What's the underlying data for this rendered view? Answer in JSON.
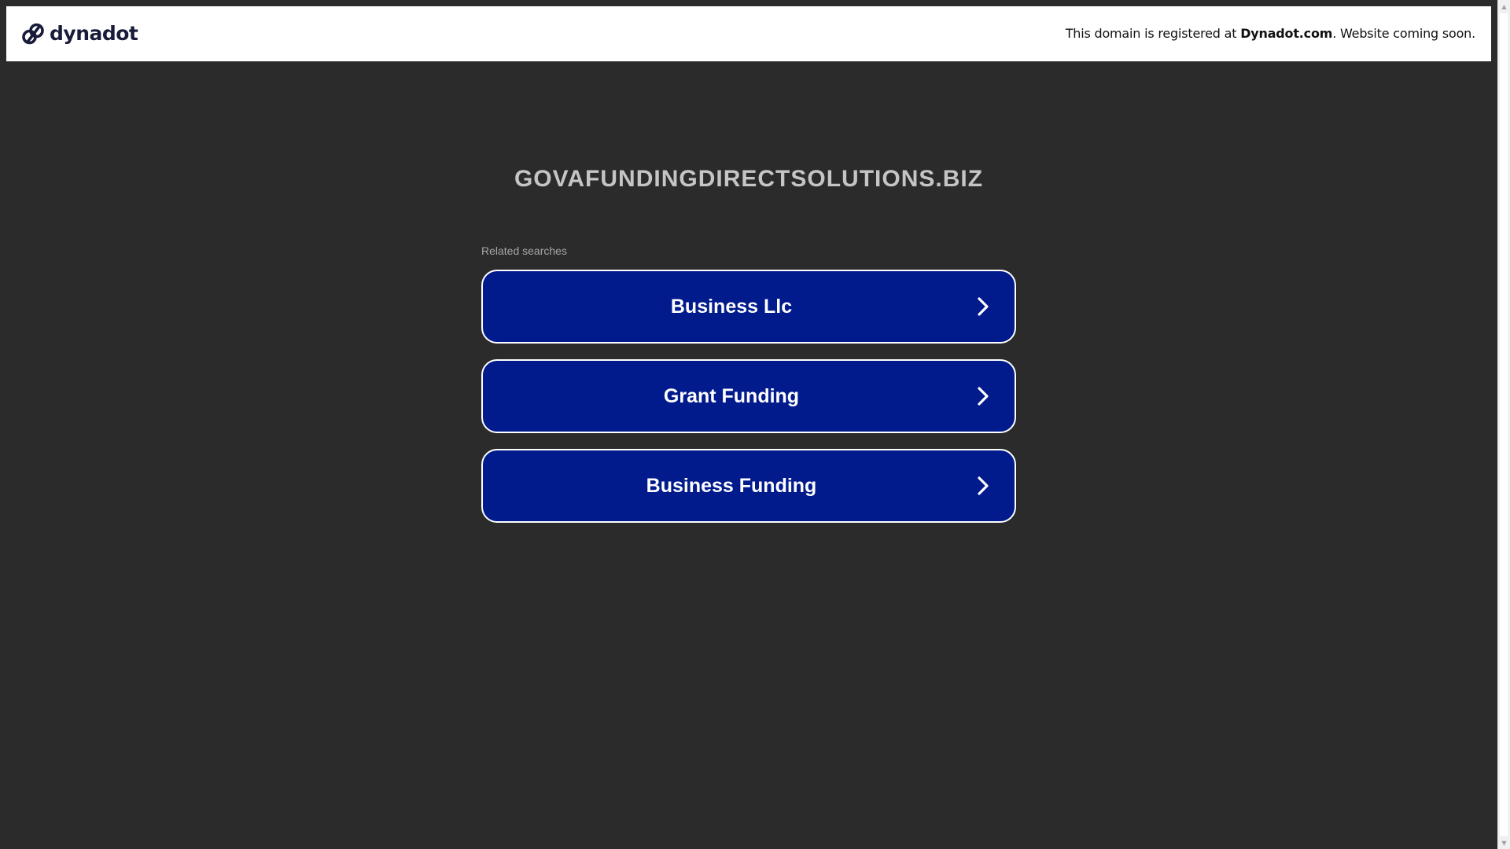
{
  "header": {
    "logo_text": "dynadot",
    "logo_icon": "dynadot-logo-icon",
    "notice_prefix": "This domain is registered at ",
    "notice_brand": "Dynadot.com",
    "notice_suffix": ". Website coming soon."
  },
  "main": {
    "domain_name": "GOVAFUNDINGDIRECTSOLUTIONS.BIZ",
    "related_label": "Related searches",
    "searches": [
      {
        "label": "Business Llc",
        "icon": "chevron-right-icon"
      },
      {
        "label": "Grant Funding",
        "icon": "chevron-right-icon"
      },
      {
        "label": "Business Funding",
        "icon": "chevron-right-icon"
      }
    ]
  },
  "colors": {
    "page_background": "#2b2b2b",
    "header_background": "#ffffff",
    "button_background": "#011a8c",
    "button_border": "#ffffff",
    "title_text": "#c5c5c5",
    "logo_text": "#191b3a"
  }
}
